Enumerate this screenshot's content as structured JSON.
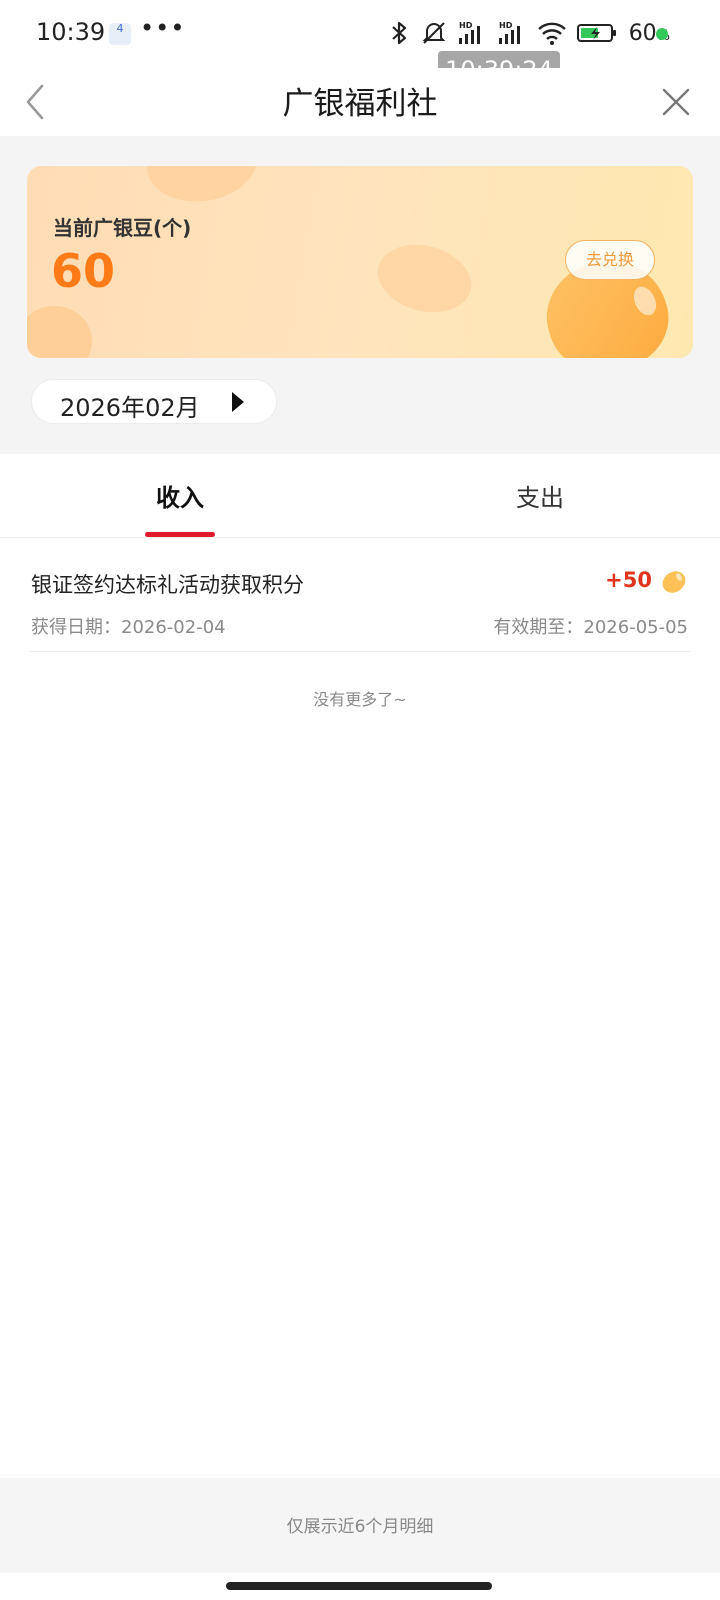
{
  "status_bar": {
    "time": "10:39",
    "app_badge": "4",
    "more": "•••",
    "battery_percent": "60",
    "battery_unit": "%"
  },
  "overlay_time": "10:39:24",
  "navbar": {
    "title": "广银福利社"
  },
  "balance": {
    "label": "当前广银豆(个)",
    "value": "60",
    "exchange_button": "去兑换"
  },
  "month_picker": {
    "value": "2026年02月"
  },
  "tabs": [
    {
      "label": "收入",
      "active": true
    },
    {
      "label": "支出",
      "active": false
    }
  ],
  "records": [
    {
      "title": "银证签约达标礼活动获取积分",
      "points": "+50",
      "date": "获得日期：2026-02-04",
      "expiry": "有效期至：2026-05-05"
    }
  ],
  "no_more": "没有更多了~",
  "footer_note": "仅展示近6个月明细",
  "colors": {
    "accent_red": "#e1192d",
    "points_red": "#e1341e",
    "balance_orange": "#ff7b17",
    "exchange_orange": "#ee9b3b"
  },
  "icons": {
    "back": "chevron-left-icon",
    "close": "close-icon",
    "bean": "bean-icon",
    "bluetooth": "bluetooth-icon",
    "mute": "bell-muted-icon",
    "signal": "signal-icon",
    "wifi": "wifi-icon",
    "battery": "battery-icon",
    "month_arrow": "triangle-right-icon"
  }
}
